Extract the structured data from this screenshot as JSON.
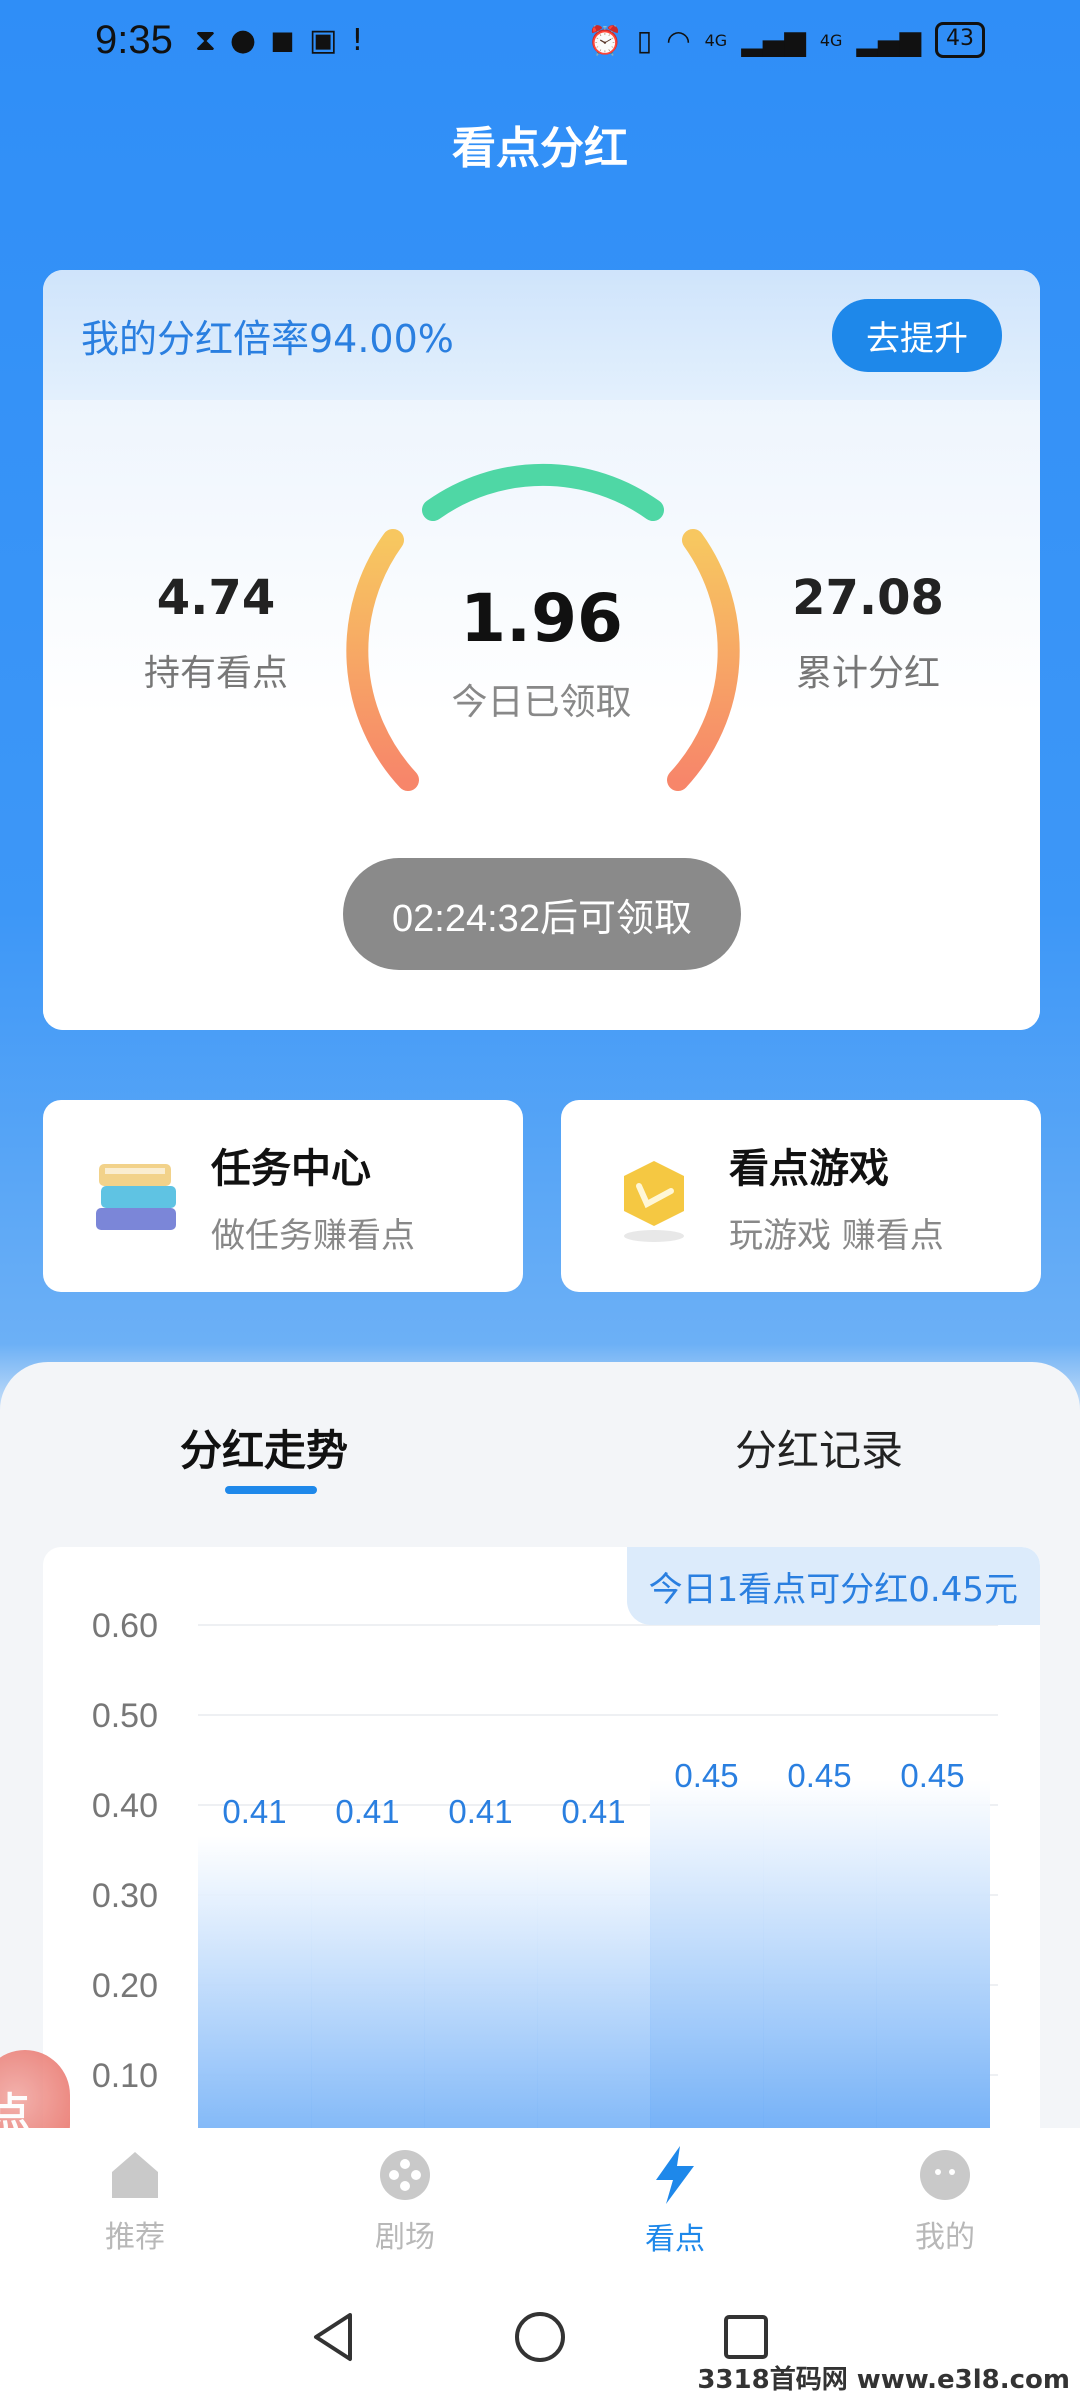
{
  "status_bar": {
    "time": "9:35",
    "battery": "43",
    "network_1": "4G",
    "network_2": "4G"
  },
  "header": {
    "title": "看点分红"
  },
  "dividend_card": {
    "rate_text": "我的分红倍率94.00%",
    "upgrade_label": "去提升",
    "left_stat": {
      "value": "4.74",
      "label": "持有看点"
    },
    "center": {
      "value": "1.96",
      "label": "今日已领取"
    },
    "right_stat": {
      "value": "27.08",
      "label": "累计分红"
    },
    "claim_button": "02:24:32后可领取"
  },
  "features": [
    {
      "title": "任务中心",
      "subtitle": "做任务赚看点",
      "icon": "books-icon"
    },
    {
      "title": "看点游戏",
      "subtitle": "玩游戏 赚看点",
      "icon": "gold-coin-icon"
    }
  ],
  "tabs": {
    "active": "分红走势",
    "inactive": "分红记录"
  },
  "chart_note": "今日1看点可分红0.45元",
  "chart_data": {
    "type": "bar",
    "categories": [
      "",
      "",
      "",
      "",
      "",
      "",
      ""
    ],
    "values": [
      0.41,
      0.41,
      0.41,
      0.41,
      0.45,
      0.45,
      0.45
    ],
    "data_labels": [
      "0.41",
      "0.41",
      "0.41",
      "0.41",
      "0.45",
      "0.45",
      "0.45"
    ],
    "yticks": [
      "0.60",
      "0.50",
      "0.40",
      "0.30",
      "0.20",
      "0.10"
    ],
    "ylim": [
      0,
      0.6
    ],
    "grid": true,
    "title": "",
    "xlabel": "",
    "ylabel": "",
    "colors": {
      "bar_top": "#ffffff",
      "bar_bottom": "#3a90f4",
      "label": "#2a7fe0"
    }
  },
  "side_float": {
    "text": "点"
  },
  "bottom_nav": [
    {
      "label": "推荐",
      "icon": "home-icon",
      "active": false
    },
    {
      "label": "剧场",
      "icon": "film-reel-icon",
      "active": false
    },
    {
      "label": "看点",
      "icon": "lightning-icon",
      "active": true
    },
    {
      "label": "我的",
      "icon": "profile-face-icon",
      "active": false
    }
  ],
  "watermark": "3318首码网 www.e3l8.com"
}
